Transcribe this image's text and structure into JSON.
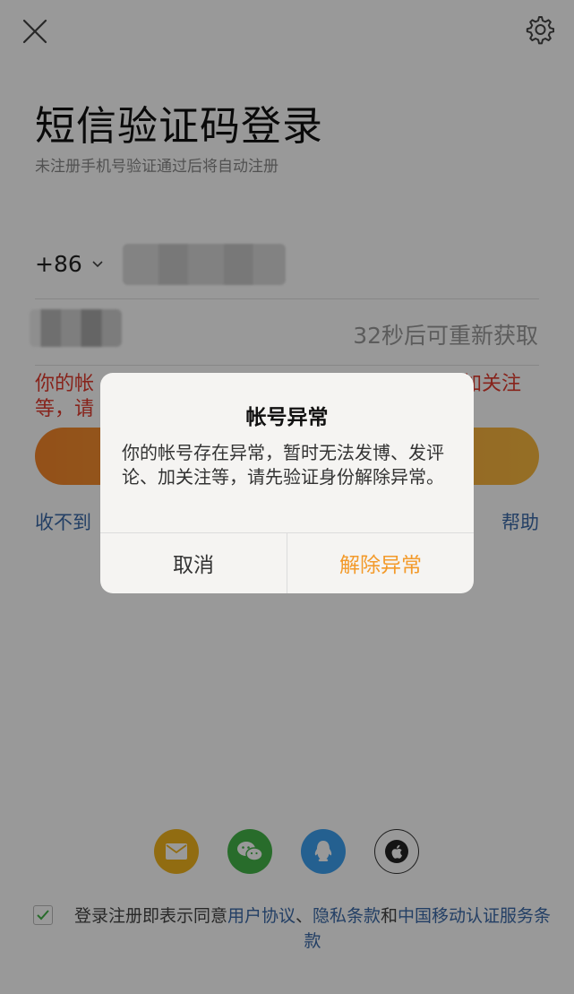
{
  "header": {
    "title": "短信验证码登录",
    "subtitle": "未注册手机号验证通过后将自动注册"
  },
  "phone": {
    "country_code": "+86"
  },
  "code": {
    "resend_text": "32秒后可重新获取"
  },
  "error": {
    "line1_start": "你的帐",
    "line1_end": "加关注",
    "line2_start": "等，请"
  },
  "links": {
    "no_code": "收不到",
    "help": "帮助"
  },
  "agreement": {
    "prefix": "登录注册即表示同意",
    "user_agreement": "用户协议",
    "sep1": "、",
    "privacy": "隐私条款",
    "and": "和",
    "cmcc_terms": "中国移动认证服务条款"
  },
  "dialog": {
    "title": "帐号异常",
    "message": "你的帐号存在异常，暂时无法发博、发评论、加关注等，请先验证身份解除异常。",
    "cancel_label": "取消",
    "confirm_label": "解除异常"
  },
  "colors": {
    "accent_orange": "#f39a2a",
    "link_blue": "#3b6aa8",
    "error_red": "#e23b2e"
  },
  "icons": [
    "close-icon",
    "gear-icon",
    "chevron-down-icon",
    "mail-icon",
    "wechat-icon",
    "qq-icon",
    "apple-icon",
    "check-icon"
  ]
}
